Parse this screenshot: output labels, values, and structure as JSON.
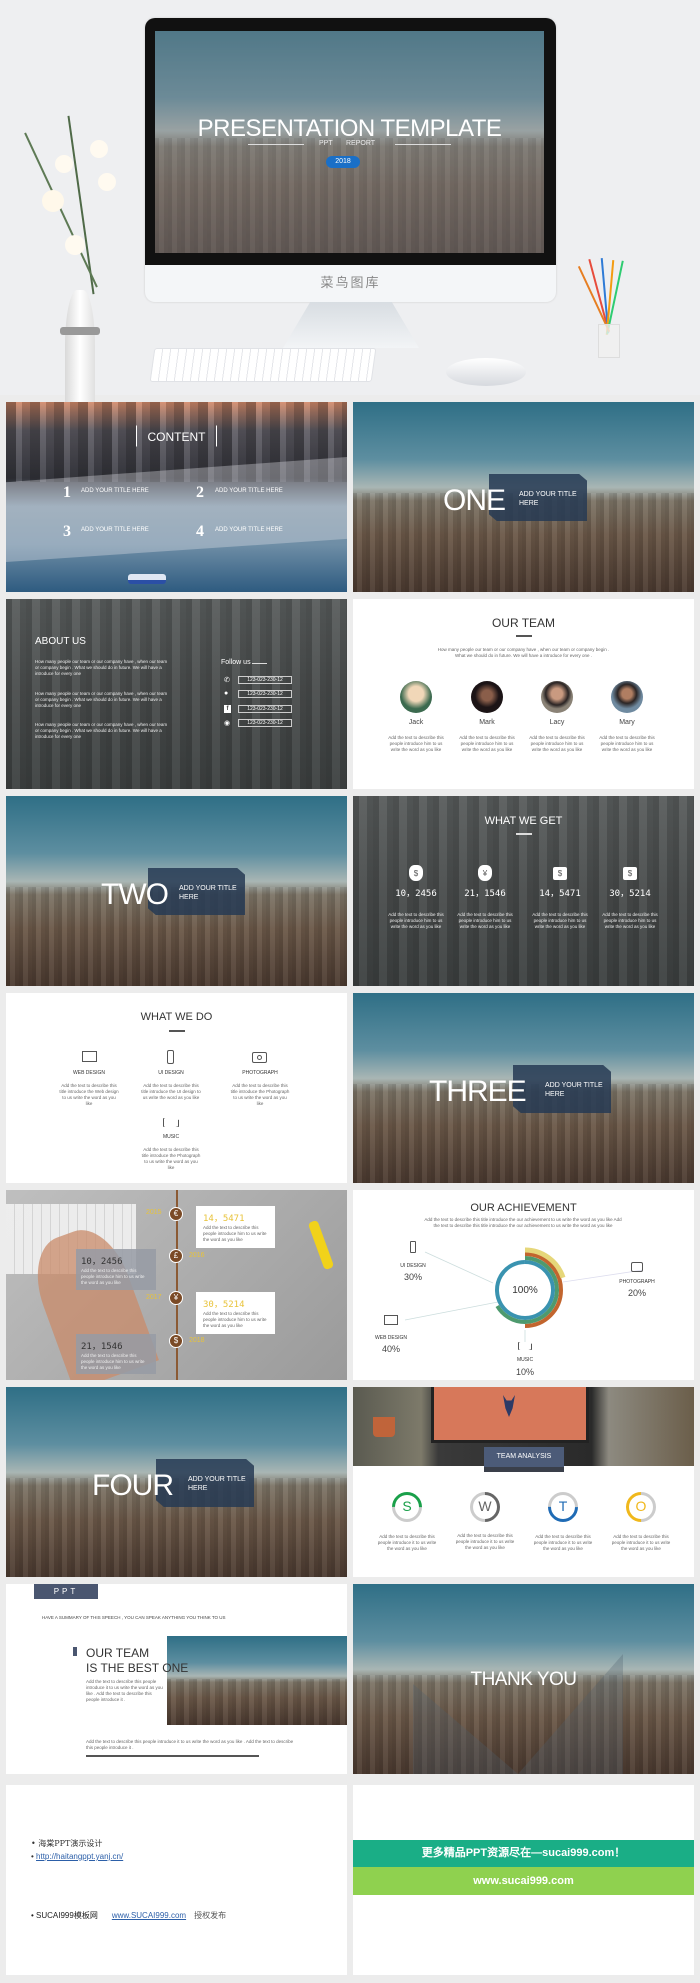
{
  "hero": {
    "title": "PRESENTATION TEMPLATE",
    "sub_left": "PPT",
    "sub_right": "REPORT",
    "year": "2018",
    "brand": "菜鸟图库"
  },
  "slides": {
    "content": {
      "title": "CONTENT",
      "items": [
        {
          "num": "1",
          "label": "ADD YOUR TITLE HERE"
        },
        {
          "num": "2",
          "label": "ADD YOUR TITLE HERE"
        },
        {
          "num": "3",
          "label": "ADD YOUR TITLE HERE"
        },
        {
          "num": "4",
          "label": "ADD YOUR TITLE HERE"
        }
      ]
    },
    "one": {
      "big": "ONE",
      "sub": "ADD YOUR TITLE HERE"
    },
    "about": {
      "title": "ABOUT US",
      "paras": [
        "How many people our team or our company have , when our team or company begin . What we should do in future. We will have a introduce for every one",
        "How many people our team or our company have , when our team or company begin . What we should do in future. We will have a introduce for every one",
        "How many people our team or our company have , when our team or company begin . What we should do in future. We will have a introduce for every one"
      ],
      "follow": "Follow us",
      "contacts": [
        {
          "icon": "phone-icon",
          "value": "123-023-230-12"
        },
        {
          "icon": "wechat-icon",
          "value": "123-023-230-12"
        },
        {
          "icon": "facebook-icon",
          "value": "123-023-230-12"
        },
        {
          "icon": "weibo-icon",
          "value": "123-023-230-12"
        }
      ]
    },
    "team": {
      "title": "OUR TEAM",
      "desc": "How many people our team or our company have , when our team or company begin . What we should do in future. We will have a introduce for every one .",
      "members": [
        {
          "name": "Jack",
          "desc": "Add the text to describe this people introduce him to us write the word as you like"
        },
        {
          "name": "Mark",
          "desc": "Add the text to describe this people introduce him to us write the word as you like"
        },
        {
          "name": "Lacy",
          "desc": "Add the text to describe this people introduce him to us write the word as you like"
        },
        {
          "name": "Mary",
          "desc": "Add the text to describe this people introduce him to us write the word as you like"
        }
      ]
    },
    "two": {
      "big": "TWO",
      "sub": "ADD YOUR TITLE HERE"
    },
    "get": {
      "title": "WHAT WE GET",
      "items": [
        {
          "icon": "dollar-bag-icon",
          "value": "10，2456",
          "desc": "Add the text to describe this people introduce him to us write the word as you like"
        },
        {
          "icon": "yen-bag-icon",
          "value": "21，1546",
          "desc": "Add the text to describe this people introduce him to us write the word as you like"
        },
        {
          "icon": "dollar-case-icon",
          "value": "14，5471",
          "desc": "Add the text to describe this people introduce him to us write the word as you like"
        },
        {
          "icon": "dollar-case-icon",
          "value": "30，5214",
          "desc": "Add the text to describe this people introduce him to us write the word as you like"
        }
      ]
    },
    "do": {
      "title": "WHAT WE DO",
      "items": [
        {
          "icon": "monitor-icon",
          "label": "WEB DESIGN",
          "desc": "Add the text to describe this title introduce the Web design to us write the word as you like"
        },
        {
          "icon": "phone-icon",
          "label": "UI DESIGN",
          "desc": "Add the text to describe this title introduce the UI design to us write the word as you like"
        },
        {
          "icon": "camera-icon",
          "label": "PHOTOGRAPH",
          "desc": "Add the text to describe this title introduce the Photograph to us write the word as you like"
        },
        {
          "icon": "music-icon",
          "label": "MUSIC",
          "desc": "Add the text to describe this title introduce the Photograph to us write the word as you like"
        }
      ]
    },
    "three": {
      "big": "THREE",
      "sub": "ADD YOUR TITLE HERE"
    },
    "timeline": {
      "accent": "#e8c33a",
      "events": [
        {
          "year": "2015",
          "symbol": "€",
          "value": "14，5471",
          "desc": "Add the text to describe this people introduce him to us write the word as you like"
        },
        {
          "year": "2016",
          "symbol": "£",
          "value": "10，2456",
          "desc": "Add the text to describe this people introduce him to us write the word as you like"
        },
        {
          "year": "2017",
          "symbol": "¥",
          "value": "30，5214",
          "desc": "Add the text to describe this people introduce him to us write the word as you like"
        },
        {
          "year": "2018",
          "symbol": "$",
          "value": "21，1546",
          "desc": "Add the text to describe this people introduce him to us write the word as you like"
        }
      ]
    },
    "achievement": {
      "title": "OUR ACHIEVEMENT",
      "desc": "Add the text to describe this title introduce the our achievement to us write the word as you like Add the text to describe this title introduce the our achievement to us write the word as you like",
      "center": "100%",
      "items": [
        {
          "label": "UI DESIGN",
          "value": "30%"
        },
        {
          "label": "PHOTOGRAPH",
          "value": "20%"
        },
        {
          "label": "WEB DESIGN",
          "value": "40%"
        },
        {
          "label": "MUSIC",
          "value": "10%"
        }
      ],
      "colors": [
        "#3a93b0",
        "#4e9a6e",
        "#c2652e",
        "#e6d77a"
      ]
    },
    "four": {
      "big": "FOUR",
      "sub": "ADD YOUR TITLE HERE"
    },
    "swot": {
      "title": "TEAM ANALYSIS",
      "items": [
        {
          "letter": "S",
          "color": "#1aa04a",
          "desc": "Add the text to describe this people introduce it to us write the word as you like"
        },
        {
          "letter": "W",
          "color": "#666666",
          "desc": "Add the text to describe this people introduce it to us write the word as you like"
        },
        {
          "letter": "T",
          "color": "#1f6bb5",
          "desc": "Add the text to describe this people introduce it to us write the word as you like"
        },
        {
          "letter": "O",
          "color": "#f0b81c",
          "desc": "Add the text to describe this people introduce it to us write the word as you like"
        }
      ]
    },
    "best": {
      "tag": "PPT",
      "summary": "HAVE A SUMMARY OF THIS SPEECH , YOU CAN SPEAK ANYTHING YOU THINK TO US",
      "line1": "OUR TEAM",
      "line2": "IS THE BEST ONE",
      "desc": "Add the text to describe this people introduce it to us write the word as you like . Add the text to describe this people introduce it .",
      "bottom": "Add the text to describe this people introduce it to us write the word as you like . Add the text to describe this people introduce it ."
    },
    "thanks": {
      "text": "THANK YOU"
    },
    "credits": {
      "line1": "海棠PPT演示设计",
      "link1": "http://haitangppt.yanj.cn/",
      "line3_prefix": "SUCAI999模板网",
      "link2": "www.SUCAI999.com",
      "line3_suffix": "授权发布"
    },
    "promo": {
      "banner": "更多精品PPT资源尽在—sucai999.com！",
      "url": "www.sucai999.com",
      "colors": [
        "#1aae86",
        "#8fd14f"
      ]
    }
  }
}
